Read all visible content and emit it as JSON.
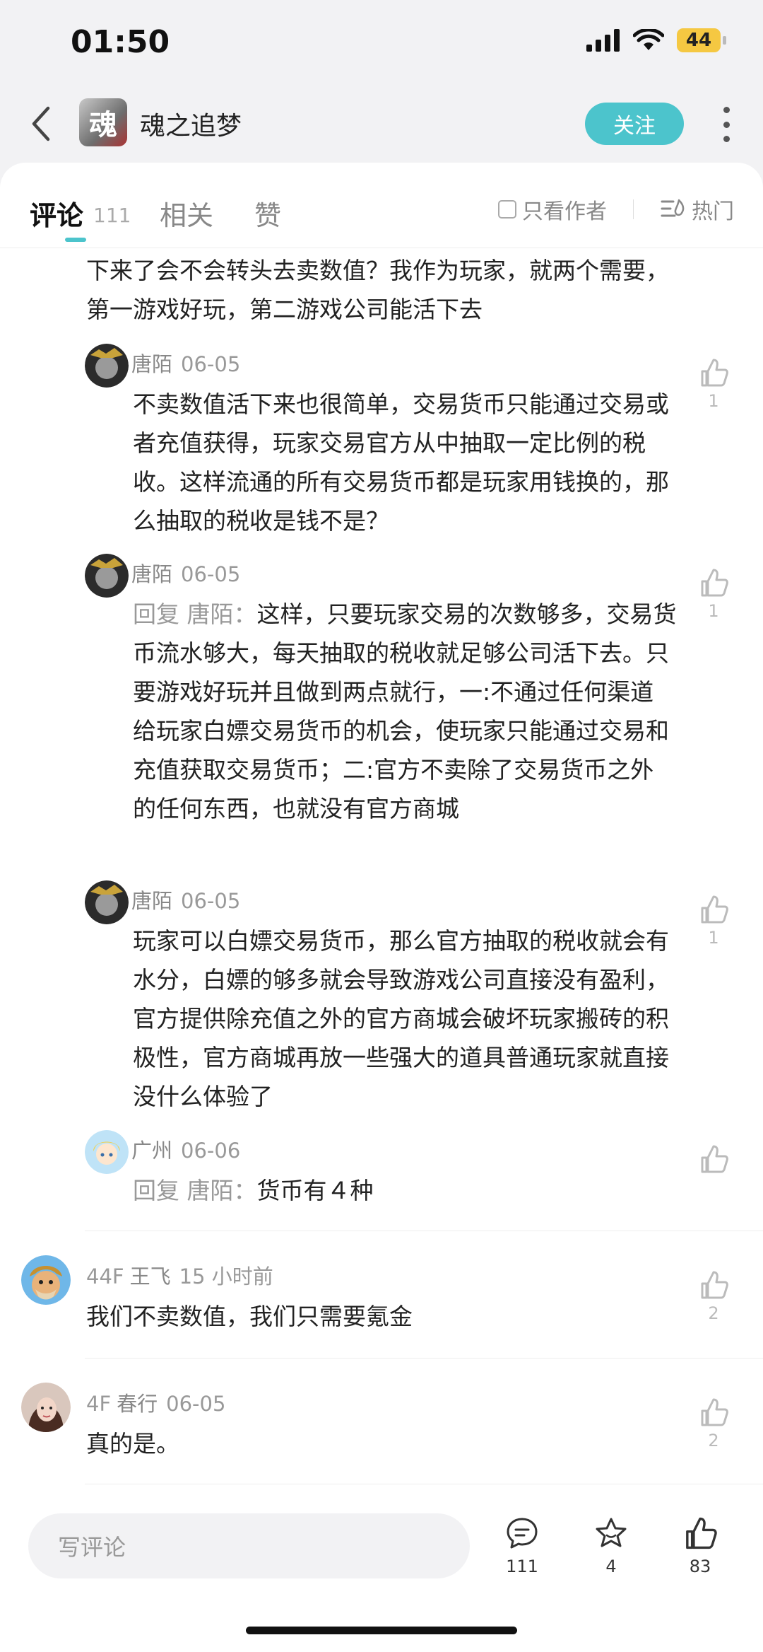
{
  "status_bar": {
    "time": "01:50",
    "battery": "44"
  },
  "header": {
    "title": "魂之追梦",
    "game_icon_char": "魂",
    "follow_label": "关注"
  },
  "tabs": {
    "comments_label": "评论",
    "comments_count": "111",
    "related_label": "相关",
    "likes_label": "赞",
    "only_author_label": "只看作者",
    "sort_label": "热门"
  },
  "thread": {
    "parent_tail": "下来了会不会转头去卖数值？我作为玩家，就两个需要，第一游戏好玩，第二游戏公司能活下去",
    "replies": [
      {
        "author": "唐陌",
        "date": "06-05",
        "text": "不卖数值活下来也很简单，交易货币只能通过交易或者充值获得，玩家交易官方从中抽取一定比例的税收。这样流通的所有交易货币都是玩家用钱换的，那么抽取的税收是钱不是？",
        "likes": "1"
      },
      {
        "author": "唐陌",
        "date": "06-05",
        "reply_prefix": "回复 唐陌：",
        "text": "这样，只要玩家交易的次数够多，交易货币流水够大，每天抽取的税收就足够公司活下去。只要游戏好玩并且做到两点就行，一:不通过任何渠道给玩家白嫖交易货币的机会，使玩家只能通过交易和充值获取交易货币；二:官方不卖除了交易货币之外的任何东西，也就没有官方商城",
        "likes": "1"
      },
      {
        "author": "唐陌",
        "date": "06-05",
        "text": "玩家可以白嫖交易货币，那么官方抽取的税收就会有水分，白嫖的够多就会导致游戏公司直接没有盈利，官方提供除充值之外的官方商城会破坏玩家搬砖的积极性，官方商城再放一些强大的道具普通玩家就直接没什么体验了",
        "likes": "1"
      },
      {
        "author": "广州",
        "date": "06-06",
        "reply_prefix": "回复 唐陌：",
        "text": "货币有４种",
        "likes": ""
      }
    ]
  },
  "comments": [
    {
      "floor": "44F",
      "author": "王飞",
      "date": "15 小时前",
      "text": "我们不卖数值，我们只需要氪金",
      "likes": "2"
    },
    {
      "floor": "4F",
      "author": "春行",
      "date": "06-05",
      "text": "真的是。",
      "likes": "2"
    }
  ],
  "bottom_bar": {
    "placeholder": "写评论",
    "comment_count": "111",
    "favorite_count": "4",
    "like_count": "83"
  },
  "colors": {
    "accent": "#4cc4cc",
    "background": "#f2f2f4"
  }
}
